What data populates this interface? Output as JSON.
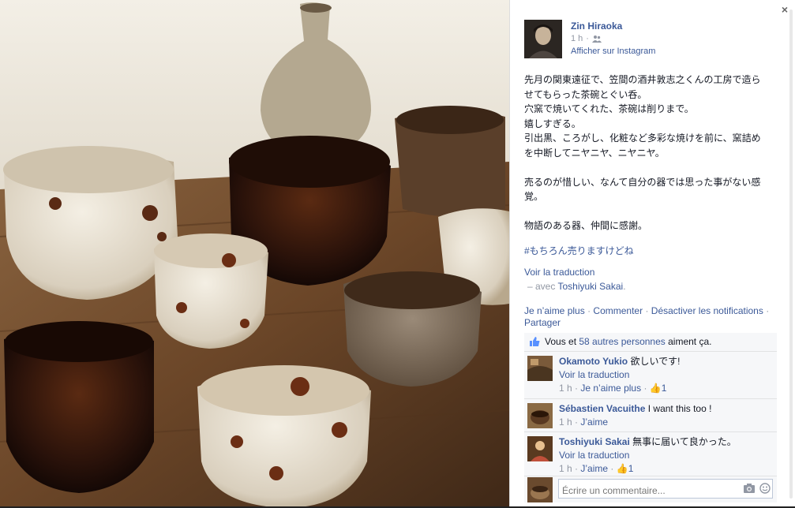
{
  "post": {
    "author": "Zin Hiraoka",
    "time": "1 h",
    "audience_icon": "friends-icon",
    "instagram_link": "Afficher sur Instagram",
    "text_lines": [
      "先月の関東遠征で、笠間の酒井敦志之くんの工房で造ら",
      "せてもらった茶碗とぐい呑。",
      "穴窯で焼いてくれた、茶碗は削りまで。",
      "嬉しすぎる。",
      "引出黒、ころがし、化粧など多彩な焼けを前に、窯詰め",
      "を中断してニヤニヤ、ニヤニヤ。",
      "",
      "売るのが惜しい、なんて自分の器では思った事がない感",
      "覚。",
      "",
      "物語のある器、仲間に感謝。"
    ],
    "hashtag": "#もちろん売りますけどね",
    "see_translation": "Voir la traduction",
    "with_prefix": "– avec",
    "with_name": "Toshiyuki Sakai",
    "with_suffix": "."
  },
  "actions": {
    "unlike": "Je n’aime plus",
    "comment": "Commenter",
    "disable_notifications": "Désactiver les notifications",
    "share": "Partager",
    "separator": "·"
  },
  "likes": {
    "prefix": "Vous et",
    "link": "58 autres personnes",
    "suffix": "aiment ça."
  },
  "comments": [
    {
      "name": "Okamoto Yukio",
      "text": "欲しいです!",
      "translate": "Voir la traduction",
      "time": "1 h",
      "action": "Je n’aime plus",
      "likes": "1"
    },
    {
      "name": "Sébastien Vacuithe",
      "text": "I want this too !",
      "time": "1 h",
      "action": "J’aime"
    },
    {
      "name": "Toshiyuki Sakai",
      "text": "無事に届いて良かった。",
      "translate": "Voir la traduction",
      "time": "1 h",
      "action": "J’aime",
      "likes": "1"
    }
  ],
  "composer": {
    "placeholder": "Écrire un commentaire..."
  },
  "colors": {
    "link": "#3b5998",
    "meta": "#9197a3",
    "ufi_bg": "#f6f7f9"
  },
  "close_label": "×"
}
